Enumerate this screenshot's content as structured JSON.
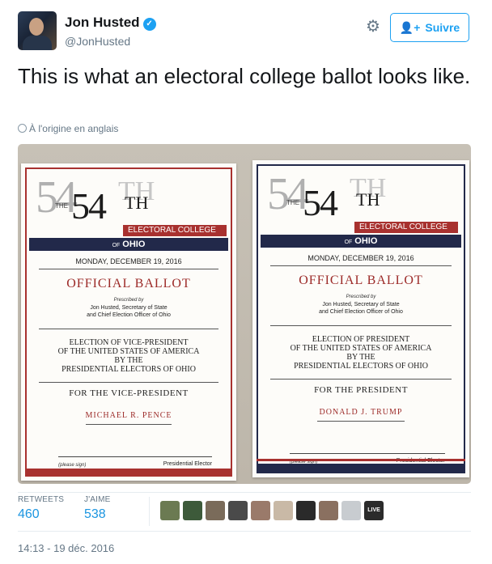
{
  "header": {
    "name": "Jon Husted",
    "verified_glyph": "✓",
    "handle": "@JonHusted",
    "follow_label": "Suivre",
    "follow_icon": "person-plus-icon",
    "settings_icon": "gear-icon"
  },
  "tweet": {
    "text": "This is what an electoral college ballot looks like.",
    "translation_note": "À l'origine en anglais"
  },
  "media": {
    "ballots": [
      {
        "the": "THE",
        "ordinal_number": "54",
        "ordinal_suffix": "TH",
        "body": "ELECTORAL COLLEGE",
        "of": "OF",
        "state": "OHIO",
        "date": "MONDAY, DECEMBER 19, 2016",
        "title": "OFFICIAL BALLOT",
        "prescribed_by": "Prescribed by",
        "prescriber": "Jon Husted, Secretary of State",
        "prescriber_role": "and Chief Election Officer of Ohio",
        "election_line1": "ELECTION OF VICE-PRESIDENT",
        "election_line2": "OF THE UNITED STATES OF AMERICA",
        "election_line3": "BY THE",
        "election_line4": "PRESIDENTIAL ELECTORS OF OHIO",
        "for_line": "FOR THE VICE-PRESIDENT",
        "candidate": "MICHAEL R. PENCE",
        "please_sign": "(please sign)",
        "signature_label": "Presidential Elector",
        "accent": "#a8312f"
      },
      {
        "the": "THE",
        "ordinal_number": "54",
        "ordinal_suffix": "TH",
        "body": "ELECTORAL COLLEGE",
        "of": "OF",
        "state": "OHIO",
        "date": "MONDAY, DECEMBER 19, 2016",
        "title": "OFFICIAL BALLOT",
        "prescribed_by": "Prescribed by",
        "prescriber": "Jon Husted, Secretary of State",
        "prescriber_role": "and Chief Election Officer of Ohio",
        "election_line1": "ELECTION OF PRESIDENT",
        "election_line2": "OF THE UNITED STATES OF AMERICA",
        "election_line3": "BY THE",
        "election_line4": "PRESIDENTIAL ELECTORS OF OHIO",
        "for_line": "FOR THE PRESIDENT",
        "candidate": "DONALD J. TRUMP",
        "please_sign": "(please sign)",
        "signature_label": "Presidential Elector",
        "accent": "#22294a"
      }
    ]
  },
  "stats": {
    "retweets_label": "RETWEETS",
    "retweets_value": "460",
    "likes_label": "J'AIME",
    "likes_value": "538"
  },
  "likers": {
    "colors": [
      "#6b7a52",
      "#3d5a3a",
      "#7a6b5a",
      "#4a4a4a",
      "#9a7a6a",
      "#c9b9a6",
      "#2a2a2a",
      "#8a7060",
      "#c8ccd0",
      "#2b2b2b"
    ],
    "logo_text": "LIVE"
  },
  "timestamp": "14:13 - 19 déc. 2016",
  "colors": {
    "link": "#1b95e0",
    "follow_border": "#1da1f2",
    "muted": "#657786"
  }
}
